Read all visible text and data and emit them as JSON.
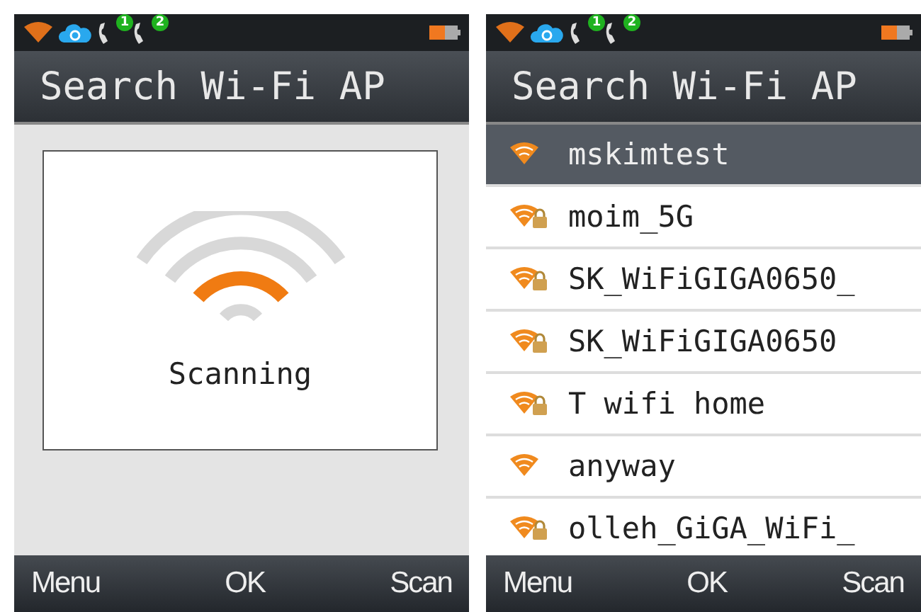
{
  "screens": [
    {
      "status_bar": {
        "badges": [
          "1",
          "2"
        ]
      },
      "title": "Search Wi-Fi AP",
      "kind": "scanning",
      "message": "Scanning",
      "softkeys": [
        "Menu",
        "OK",
        "Scan"
      ]
    },
    {
      "status_bar": {
        "badges": [
          "1",
          "2"
        ]
      },
      "title": "Search Wi-Fi AP",
      "kind": "list",
      "networks": [
        {
          "name": "mskimtest",
          "secured": false,
          "selected": true
        },
        {
          "name": "moim_5G",
          "secured": true,
          "selected": false
        },
        {
          "name": "SK_WiFiGIGA0650_",
          "secured": true,
          "selected": false
        },
        {
          "name": "SK_WiFiGIGA0650",
          "secured": true,
          "selected": false
        },
        {
          "name": "T wifi home",
          "secured": true,
          "selected": false
        },
        {
          "name": "anyway",
          "secured": false,
          "selected": false
        },
        {
          "name": "olleh_GiGA_WiFi_",
          "secured": true,
          "selected": false
        }
      ],
      "softkeys": [
        "Menu",
        "OK",
        "Scan"
      ]
    }
  ]
}
